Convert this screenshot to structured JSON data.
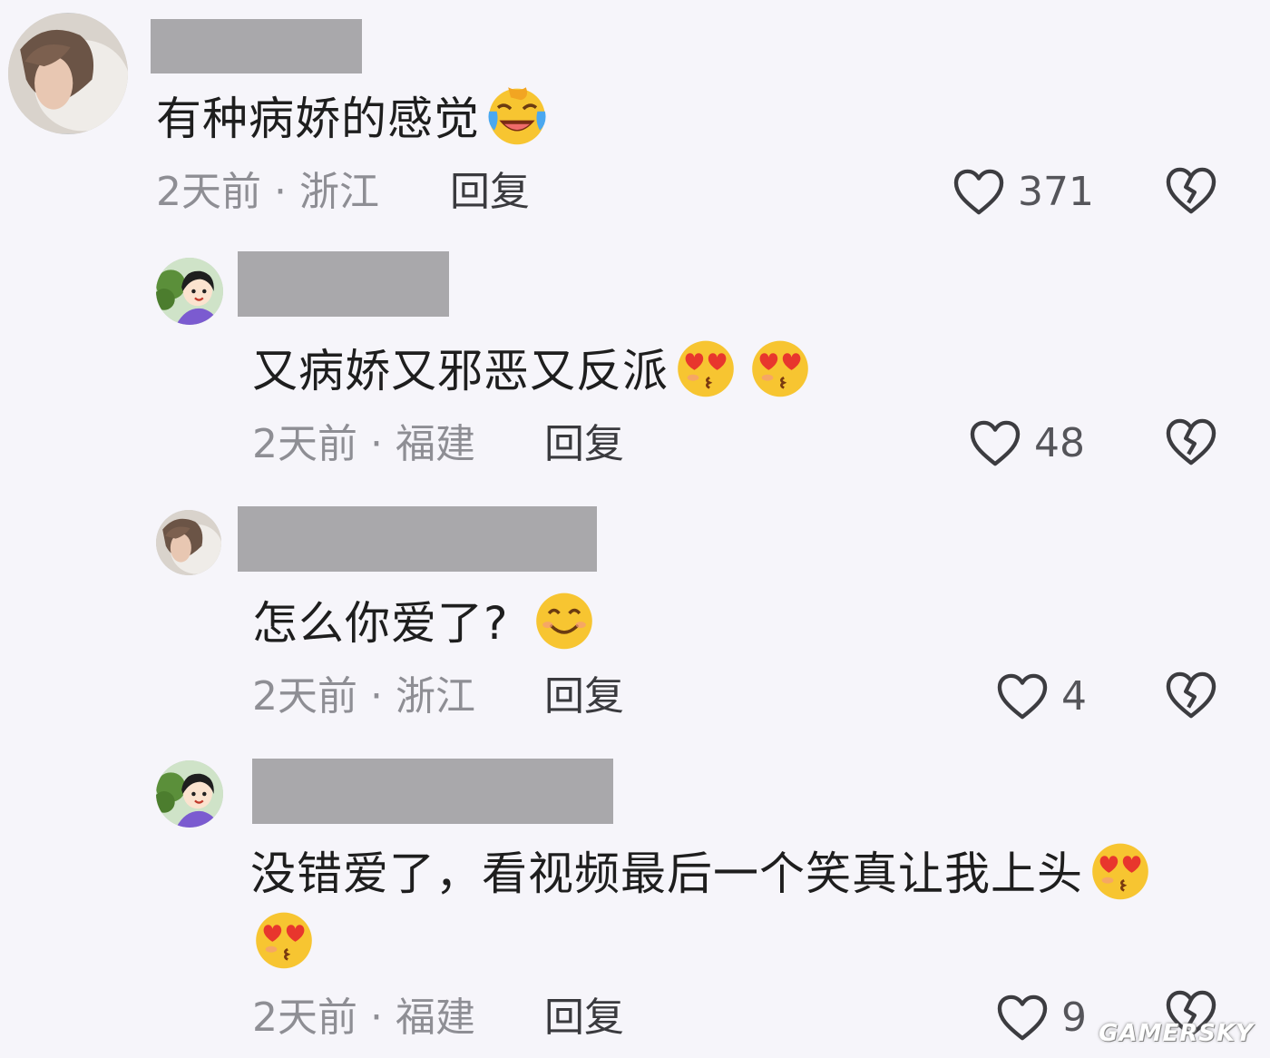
{
  "comments": [
    {
      "text": "有种病娇的感觉",
      "emojis": [
        "laughing-crying-emoji"
      ],
      "time": "2天前",
      "location": "浙江",
      "reply_label": "回复",
      "likes": "371"
    },
    {
      "text": "又病娇又邪恶又反派",
      "emojis": [
        "heart-eyes-kiss-emoji",
        "heart-eyes-kiss-emoji"
      ],
      "time": "2天前",
      "location": "福建",
      "reply_label": "回复",
      "likes": "48"
    },
    {
      "text": "怎么你爱了?",
      "emojis": [
        "smile-emoji"
      ],
      "time": "2天前",
      "location": "浙江",
      "reply_label": "回复",
      "likes": "4"
    },
    {
      "text": "没错爱了，看视频最后一个笑真让我上头",
      "emojis": [
        "heart-eyes-kiss-emoji",
        "heart-eyes-kiss-emoji"
      ],
      "time": "2天前",
      "location": "福建",
      "reply_label": "回复",
      "likes": "9"
    }
  ],
  "meta_separator": " · ",
  "watermark": "GAMERSKY",
  "colors": {
    "background": "#f6f5fa",
    "name_mask": "#a9a8ab",
    "meta_text": "#8e8e94",
    "reply_text": "#3a3a3e"
  }
}
